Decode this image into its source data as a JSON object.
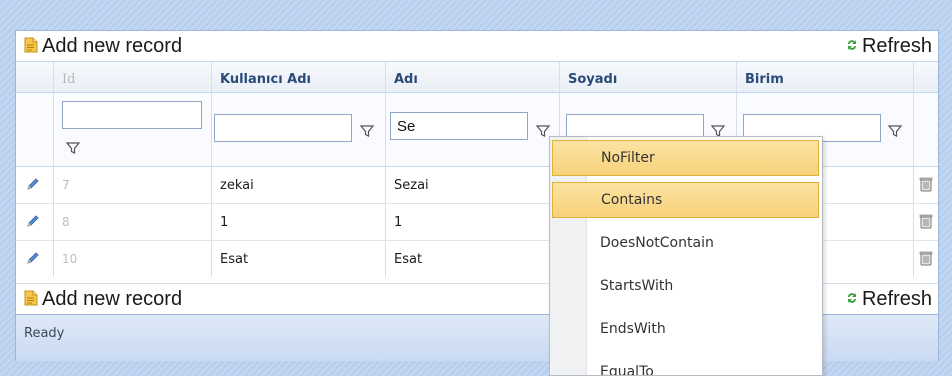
{
  "toolbar": {
    "add_label": "Add new record",
    "refresh_label": "Refresh"
  },
  "columns": [
    "Id",
    "Kullanıcı Adı",
    "Adı",
    "Soyadı",
    "Birim"
  ],
  "filters": {
    "id": "",
    "kullanici_adi": "",
    "adi": "Se",
    "soyadi": "",
    "birim": ""
  },
  "rows": [
    {
      "id": "7",
      "kullanici_adi": "zekai",
      "adi": "Sezai"
    },
    {
      "id": "8",
      "kullanici_adi": "1",
      "adi": "1"
    },
    {
      "id": "10",
      "kullanici_adi": "Esat",
      "adi": "Esat"
    }
  ],
  "status": "Ready",
  "filter_menu": [
    "NoFilter",
    "Contains",
    "DoesNotContain",
    "StartsWith",
    "EndsWith",
    "EqualTo"
  ],
  "colors": {
    "accent_border": "#9ab6dc",
    "highlight": "#f7d27a",
    "header_text": "#2a4a78"
  }
}
